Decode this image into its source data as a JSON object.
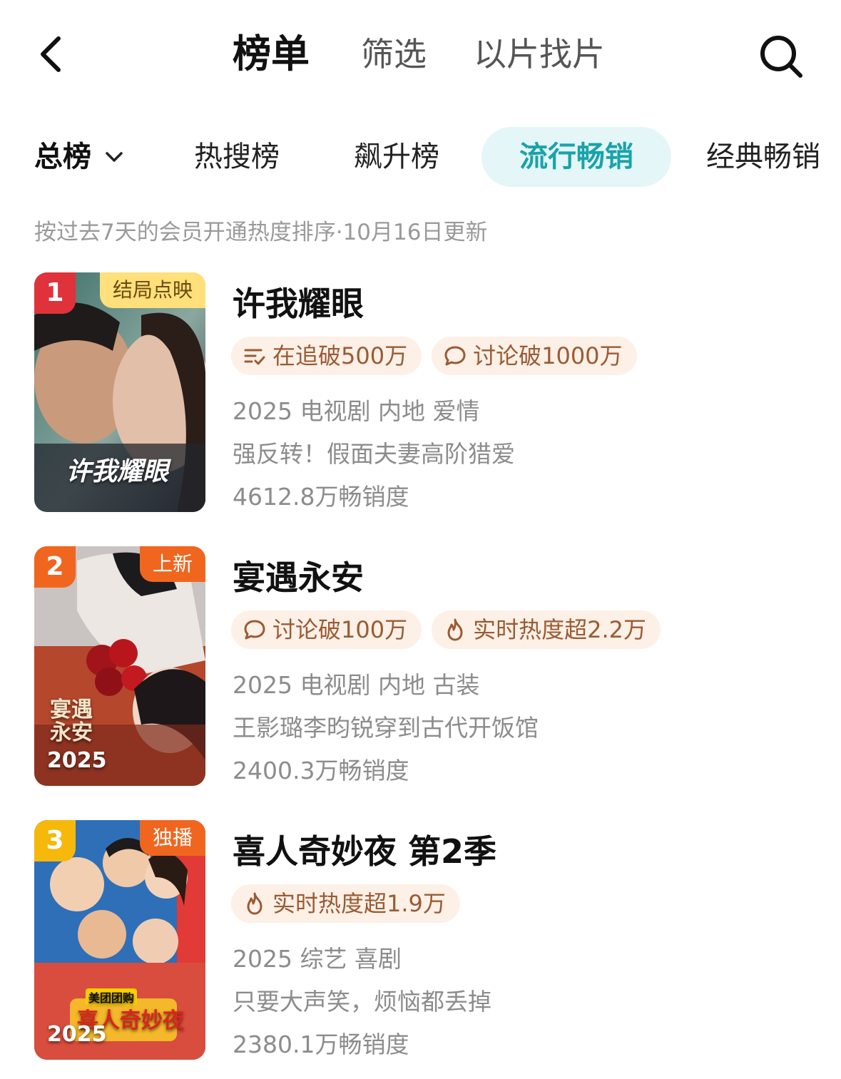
{
  "header": {
    "tabs": [
      {
        "label": "榜单"
      },
      {
        "label": "筛选"
      },
      {
        "label": "以片找片"
      }
    ]
  },
  "categories": [
    {
      "label": "总榜"
    },
    {
      "label": "热搜榜"
    },
    {
      "label": "飙升榜"
    },
    {
      "label": "流行畅销"
    },
    {
      "label": "经典畅销"
    }
  ],
  "selected_category": "流行畅销",
  "subtitle": "按过去7天的会员开通热度排序·10月16日更新",
  "colors": {
    "accent": "#19a3aa",
    "accent_bg": "#e4f6f7",
    "badge_bg": "#fdf0e7",
    "badge_text": "#9a5b34",
    "rank1": "#e0323b",
    "rank2": "#f0661f",
    "rank3": "#f5b80b",
    "tag_yellow": "#ffe07a",
    "tag_orange": "#f0661f"
  },
  "items": [
    {
      "rank": "1",
      "corner_tag": "结局点映",
      "title": "许我耀眼",
      "poster_art": "许我耀眼",
      "poster_year": "",
      "badges": [
        {
          "icon": "list-check-icon",
          "text": "在追破500万"
        },
        {
          "icon": "chat-bubble-icon",
          "text": "讨论破1000万"
        }
      ],
      "info": "2025 电视剧 内地 爱情",
      "desc": "强反转！假面夫妻高阶猎爱",
      "sales": "4612.8万畅销度"
    },
    {
      "rank": "2",
      "corner_tag": "上新",
      "title": "宴遇永安",
      "poster_art": "宴遇永安",
      "poster_year": "2025",
      "badges": [
        {
          "icon": "chat-bubble-icon",
          "text": "讨论破100万"
        },
        {
          "icon": "flame-icon",
          "text": "实时热度超2.2万"
        }
      ],
      "info": "2025 电视剧 内地 古装",
      "desc": "王影璐李昀锐穿到古代开饭馆",
      "sales": "2400.3万畅销度"
    },
    {
      "rank": "3",
      "corner_tag": "独播",
      "title": "喜人奇妙夜 第2季",
      "poster_art": "喜人奇妙夜",
      "poster_sub": "美团团购",
      "poster_year": "2025",
      "badges": [
        {
          "icon": "flame-icon",
          "text": "实时热度超1.9万"
        }
      ],
      "info": "2025 综艺 喜剧",
      "desc": "只要大声笑，烦恼都丢掉",
      "sales": "2380.1万畅销度"
    }
  ]
}
